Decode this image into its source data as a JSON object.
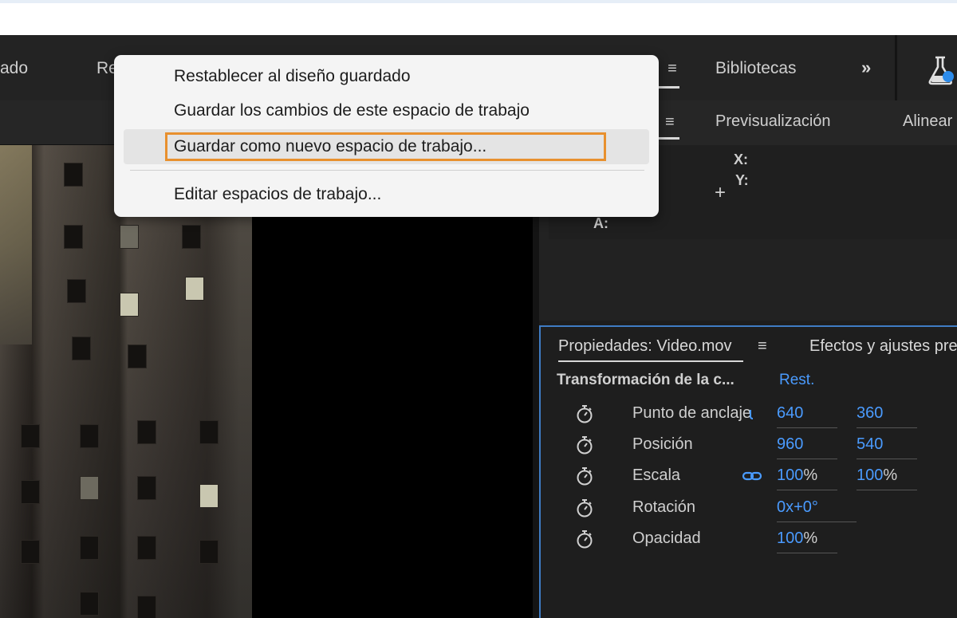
{
  "workspace_bar": {
    "tabs": [
      {
        "label": "ado"
      },
      {
        "label": "Re"
      },
      {
        "label": "Bibliotecas"
      }
    ],
    "menu_icon": "hamburger-icon",
    "more_icon": "chevron-double-right-icon",
    "labs_icon": "flask-icon"
  },
  "context_menu": {
    "items": [
      {
        "label": "Restablecer al diseño guardado"
      },
      {
        "label": "Guardar los cambios de este espacio de trabajo"
      },
      {
        "label": "Guardar como nuevo espacio de trabajo..."
      },
      {
        "label": "Editar espacios de trabajo..."
      }
    ],
    "highlight_color": "#e8902e"
  },
  "info_panel": {
    "tabs": [
      {
        "label": "Previsualización"
      },
      {
        "label": "Alinear"
      }
    ],
    "x_label": "X:",
    "y_label": "Y:",
    "a_label": "A:"
  },
  "properties": {
    "tab_title": "Propiedades: Video.mov",
    "tab_other": "Efectos y ajustes pre",
    "section_title": "Transformación de la c...",
    "reset_label": "Rest.",
    "rows": [
      {
        "label": "Punto de anclaje",
        "v1": "640",
        "v2": "360"
      },
      {
        "label": "Posición",
        "v1": "960",
        "v2": "540"
      },
      {
        "label": "Escala",
        "v1": "100",
        "v1_unit": "%",
        "v2": "100",
        "v2_unit": "%"
      },
      {
        "label": "Rotación",
        "v1": "0x+0°"
      },
      {
        "label": "Opacidad",
        "v1": "100",
        "v1_unit": "%"
      }
    ],
    "accent_color": "#4a9bff"
  }
}
